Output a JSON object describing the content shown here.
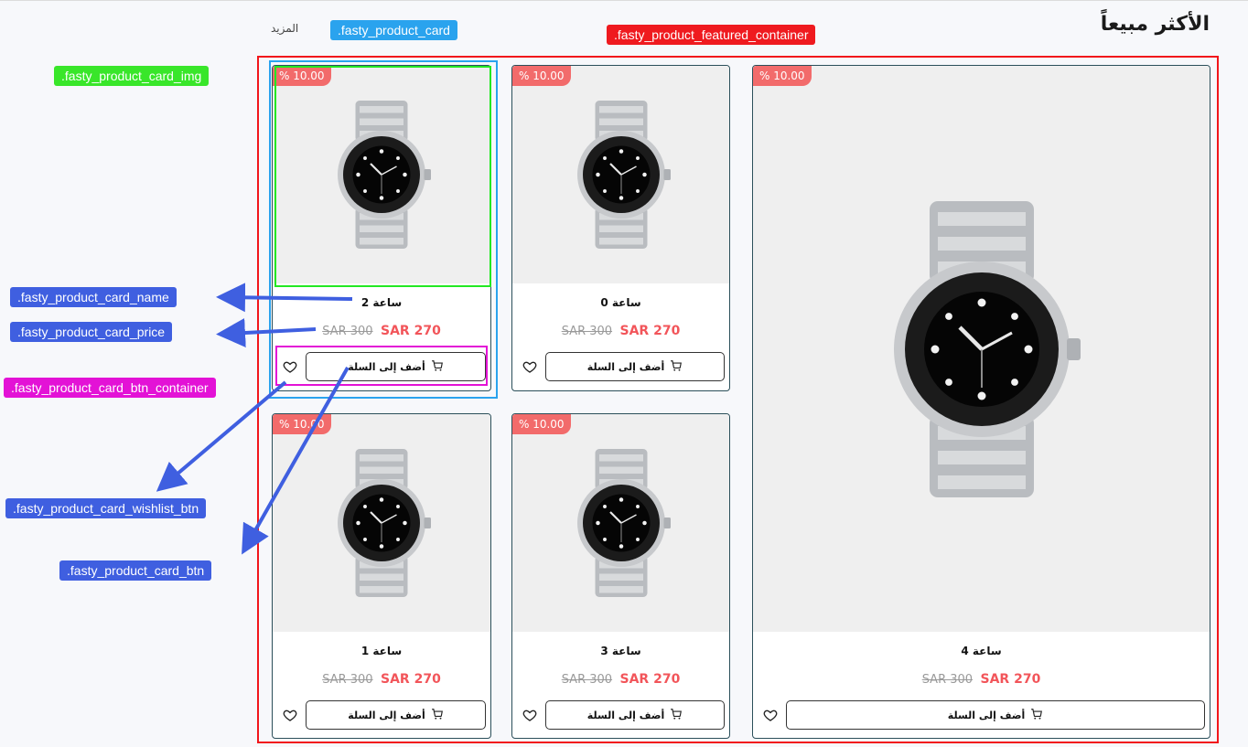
{
  "header": {
    "title": "الأكثر مبيعاً",
    "more_label": "المزيد"
  },
  "products": [
    {
      "name": "ساعة 2",
      "old_price": "SAR 300",
      "new_price": "SAR 270",
      "discount": "% 10.00",
      "button": "أضف إلى السلة"
    },
    {
      "name": "ساعة 0",
      "old_price": "SAR 300",
      "new_price": "SAR 270",
      "discount": "% 10.00",
      "button": "أضف إلى السلة"
    },
    {
      "name": "ساعة 1",
      "old_price": "SAR 300",
      "new_price": "SAR 270",
      "discount": "% 10.00",
      "button": "أضف إلى السلة"
    },
    {
      "name": "ساعة 3",
      "old_price": "SAR 300",
      "new_price": "SAR 270",
      "discount": "% 10.00",
      "button": "أضف إلى السلة"
    },
    {
      "name": "ساعة 4",
      "old_price": "SAR 300",
      "new_price": "SAR 270",
      "discount": "% 10.00",
      "button": "أضف إلى السلة"
    }
  ],
  "annotations": {
    "featured_container": ".fasty_product_featured_container",
    "card": ".fasty_product_card",
    "card_img": ".fasty_product_card_img",
    "card_name": ".fasty_product_card_name",
    "card_price": ".fasty_product_card_price",
    "btn_container": ".fasty_product_card_btn_container",
    "wishlist_btn": ".fasty_product_card_wishlist_btn",
    "card_btn": ".fasty_product_card_btn"
  },
  "colors": {
    "accent_red": "#f2161b",
    "price_red": "#f2555a",
    "badge": "#f26b6b",
    "annotation_blue": "#3f5fe0",
    "annotation_sky": "#2aa3ee",
    "annotation_green": "#39e62a",
    "annotation_pink": "#e312d6"
  }
}
